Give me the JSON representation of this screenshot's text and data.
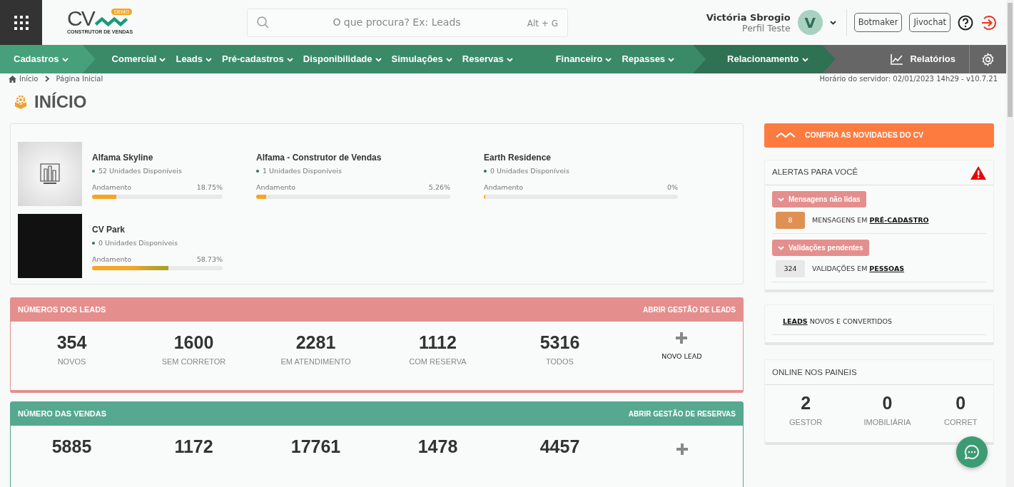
{
  "header": {
    "logo": {
      "text": "CV",
      "badge": "DEMO",
      "tagline": "CONSTRUTOR DE VENDAS"
    },
    "search": {
      "placeholder": "O que procura? Ex: Leads",
      "shortcut": "Alt + G"
    },
    "user": {
      "name": "Victória Sbrogio",
      "profile": "Perfil Teste",
      "initial": "V"
    },
    "buttons": [
      "Botmaker",
      "Jivochat"
    ]
  },
  "menu": {
    "groups": [
      {
        "kind": "light",
        "clusters": [
          [
            "Cadastros"
          ]
        ]
      },
      {
        "kind": "mid",
        "clusters": [
          [
            "Comercial",
            "Leads",
            "Pré-cadastros",
            "Disponibilidade",
            "Simulações",
            "Reservas"
          ],
          [
            "Financeiro",
            "Repasses"
          ]
        ]
      },
      {
        "kind": "dark",
        "clusters": [
          [
            "Relacionamento"
          ]
        ]
      }
    ],
    "reports": "Relatórios"
  },
  "breadcrumb": [
    "Início",
    "Página Inicial"
  ],
  "server_time": "Horário do servidor: 02/01/2023 14h29 - v10.7.21",
  "page_title": "INÍCIO",
  "projects": [
    {
      "name": "Alfama Skyline",
      "units": "52 Unidades Disponíveis",
      "progress_label": "Andamento",
      "percent": "18.75%",
      "level": 0.1875,
      "kind": "logo"
    },
    {
      "name": "Alfama - Construtor de Vendas",
      "units": "1 Unidades Disponíveis",
      "progress_label": "Andamento",
      "percent": "5.26%",
      "level": 0.0526,
      "kind": "plain"
    },
    {
      "name": "Earth Residence",
      "units": "0 Unidades Disponíveis",
      "progress_label": "Andamento",
      "percent": "0%",
      "level": 0,
      "kind": "plain"
    },
    {
      "name": "CV Park",
      "units": "0 Unidades Disponíveis",
      "progress_label": "Andamento",
      "percent": "58.73%",
      "level": 0.5873,
      "kind": "photo"
    }
  ],
  "leads_panel": {
    "title": "NÚMEROS DOS LEADS",
    "action": "ABRIR GESTÃO DE LEADS",
    "stats": [
      {
        "value": "354",
        "label": "NOVOS"
      },
      {
        "value": "1600",
        "label": "SEM CORRETOR"
      },
      {
        "value": "2281",
        "label": "EM ATENDIMENTO"
      },
      {
        "value": "1112",
        "label": "COM RESERVA"
      },
      {
        "value": "5316",
        "label": "TODOS"
      }
    ],
    "add_label": "NOVO LEAD"
  },
  "sales_panel": {
    "title": "NÚMERO DAS VENDAS",
    "action": "ABRIR GESTÃO DE RESERVAS",
    "stats": [
      {
        "value": "5885"
      },
      {
        "value": "1172"
      },
      {
        "value": "17761"
      },
      {
        "value": "1478"
      },
      {
        "value": "4457"
      }
    ]
  },
  "news_banner": "CONFIRA AS NOVIDADES DO CV",
  "alerts": {
    "title": "ALERTAS PARA VOCÊ",
    "groups": [
      {
        "label": "Mensagens não lidas",
        "expanded": true,
        "items": [
          {
            "count": "8",
            "color": "#de9152",
            "text": "MENSAGENS EM",
            "link": "PRÉ-CADASTRO"
          }
        ]
      },
      {
        "label": "Validações pendentes",
        "expanded": true,
        "items": [
          {
            "count": "324",
            "color": "#e8e8e8",
            "text": "VALIDAÇÕES EM",
            "link": "PESSOAS"
          }
        ]
      }
    ]
  },
  "leads_card": {
    "link": "LEADS",
    "text": "NOVOS E CONVERTIDOS"
  },
  "online": {
    "title": "ONLINE NOS PAINEIS",
    "stats": [
      {
        "value": "2",
        "label": "GESTOR"
      },
      {
        "value": "0",
        "label": "IMOBILIÁRIA"
      },
      {
        "value": "0",
        "label": "CORRET"
      }
    ]
  }
}
